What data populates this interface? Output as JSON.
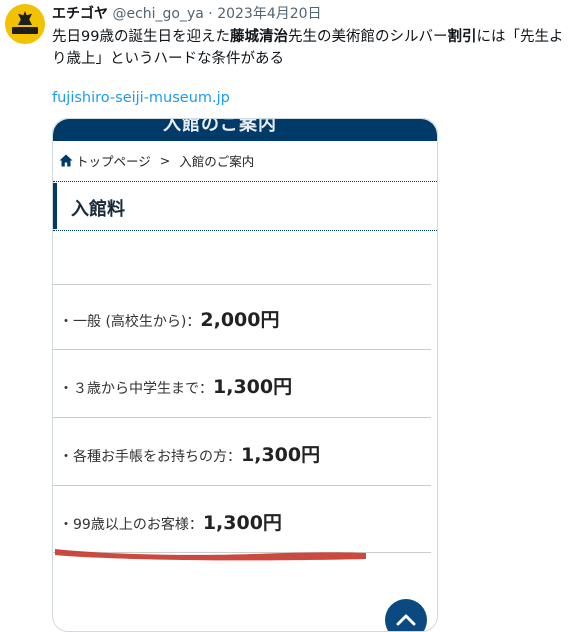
{
  "author": {
    "name": "エチゴヤ",
    "handle": "@echi_go_ya",
    "separator": "·",
    "date": "2023年4月20日",
    "avatar_icon": "samurai-emblem-icon"
  },
  "tweet": {
    "text_part1": "先日99歳の誕生日を迎えた",
    "text_bold1": "藤城清治",
    "text_part2": "先生の美術館のシルバー",
    "text_bold2": "割引",
    "text_part3": "には「先生より歳上」というハードな条件がある"
  },
  "link": {
    "domain": "fujishiro-seiji-museum.jp"
  },
  "screenshot": {
    "header_text": "入館のご案内",
    "breadcrumb": {
      "home": "トップページ",
      "separator": ">",
      "current": "入館のご案内"
    },
    "section_title": "入館料",
    "prices": [
      {
        "label": "・一般 (高校生から)：",
        "price": "2,000円"
      },
      {
        "label": "・３歳から中学生まで：",
        "price": "1,300円"
      },
      {
        "label": "・各種お手帳をお持ちの方：",
        "price": "1,300円"
      },
      {
        "label": "・99歳以上のお客様：",
        "price": "1,300円"
      }
    ],
    "scroll_top_icon": "chevron-up-icon"
  },
  "colors": {
    "link": "#1d9bf0",
    "navy": "#003a68",
    "annotation_red": "#c8392f"
  }
}
